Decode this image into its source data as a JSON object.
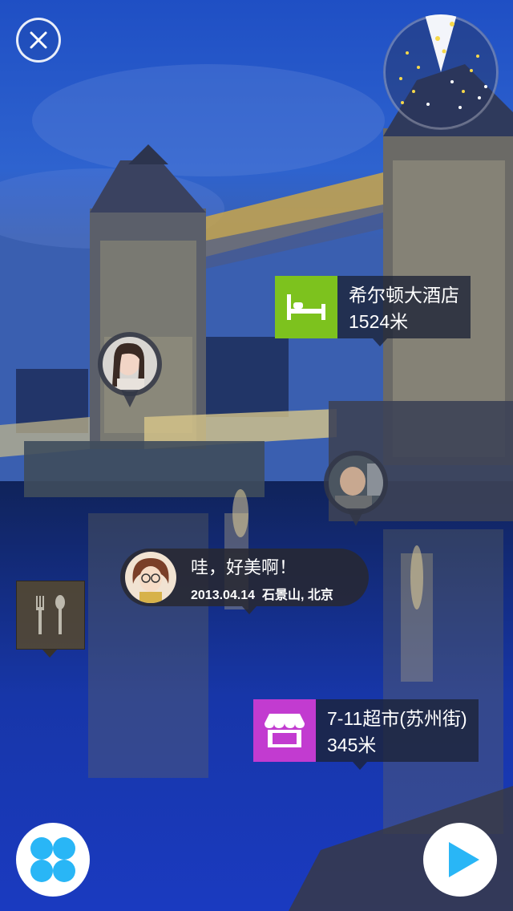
{
  "controls": {
    "close_icon": "close-icon",
    "menu_icon": "four-dots-icon",
    "play_icon": "play-icon",
    "accent_color": "#29b6f6"
  },
  "radar": {
    "icon": "radar-icon"
  },
  "pois": [
    {
      "name": "希尔顿大酒店",
      "distance": "1524米",
      "icon": "bed-icon",
      "color": "#7dc21e"
    },
    {
      "name": "7-11超市(苏州街)",
      "distance": "345米",
      "icon": "store-icon",
      "color": "#c23bd0"
    }
  ],
  "message": {
    "text": "哇，好美啊！",
    "date": "2013.04.14",
    "location": "石景山, 北京"
  },
  "food_marker": {
    "icon": "fork-spoon-icon"
  }
}
